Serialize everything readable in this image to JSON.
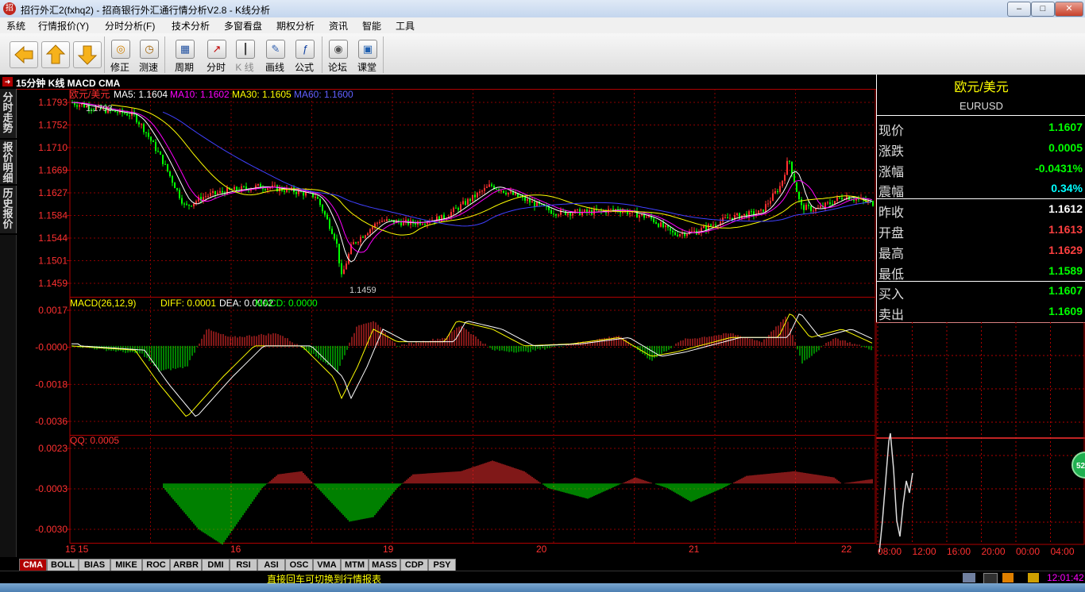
{
  "window": {
    "title": "招行外汇2(fxhq2) - 招商银行外汇通行情分析V2.8 - K线分析"
  },
  "menu": [
    "系统",
    "行情报价(Y)",
    "分时分析(F)",
    "技术分析",
    "多窗看盘",
    "期权分析",
    "资讯",
    "智能",
    "工具"
  ],
  "toolbar": {
    "buttons": [
      "修正",
      "测速",
      "周期",
      "分时",
      "K 线",
      "画线",
      "公式",
      "论坛",
      "课堂"
    ]
  },
  "side_tabs": [
    "分时走势",
    "报价明细",
    "历史报价"
  ],
  "chart_header": "15分钟 K线 MACD CMA",
  "price_panel": {
    "legend": {
      "name": "欧元/美元",
      "ma5": "MA5: 1.1604",
      "ma10": "MA10: 1.1602",
      "ma30": "MA30: 1.1605",
      "ma60": "MA60: 1.1600"
    },
    "y_ticks": [
      "1.1793",
      "1.1752",
      "1.1710",
      "1.1669",
      "1.1627",
      "1.1584",
      "1.1544",
      "1.1501",
      "1.1459"
    ],
    "high_label": "1.1793",
    "low_label": "1.1459"
  },
  "macd_panel": {
    "legend": {
      "name": "MACD(26,12,9)",
      "diff": "DIFF: 0.0001",
      "dea": "DEA: 0.0002",
      "macd": "MACD: 0.0000"
    },
    "y_ticks": [
      "0.0017",
      "-0.0000",
      "-0.0018",
      "-0.0036"
    ]
  },
  "qq_panel": {
    "legend": "QQ: 0.0005",
    "y_ticks": [
      "0.0023",
      "-0.0003",
      "-0.0030"
    ]
  },
  "x_axis": {
    "labels": [
      "15",
      "15",
      "16",
      "19",
      "20",
      "21",
      "22"
    ]
  },
  "quote": {
    "name": "欧元/美元",
    "code": "EURUSD",
    "rows": [
      {
        "k": "现价",
        "v": "1.1607",
        "c": "#00ff00"
      },
      {
        "k": "涨跌",
        "v": "0.0005",
        "c": "#00ff00"
      },
      {
        "k": "涨幅",
        "v": "-0.0431%",
        "c": "#00ff00"
      },
      {
        "k": "震幅",
        "v": "0.34%",
        "c": "#00ffff"
      },
      {
        "k": "昨收",
        "v": "1.1612",
        "c": "#ffffff"
      },
      {
        "k": "开盘",
        "v": "1.1613",
        "c": "#ff4040"
      },
      {
        "k": "最高",
        "v": "1.1629",
        "c": "#ff4040"
      },
      {
        "k": "最低",
        "v": "1.1589",
        "c": "#00ff00"
      },
      {
        "k": "买入",
        "v": "1.1607",
        "c": "#00ff00"
      },
      {
        "k": "卖出",
        "v": "1.1609",
        "c": "#00ff00"
      }
    ]
  },
  "mini_chart": {
    "x_labels": [
      "08:00",
      "12:00",
      "16:00",
      "20:00",
      "00:00",
      "04:00"
    ],
    "badge": "52"
  },
  "bottom_tabs": [
    "CMA",
    "BOLL",
    "BIAS",
    "MIKE",
    "ROC",
    "ARBR",
    "DMI",
    "RSI",
    "ASI",
    "OSC",
    "VMA",
    "MTM",
    "MASS",
    "CDP",
    "PSY"
  ],
  "status": {
    "message": "直接回车可切换到行情报表",
    "time": "12:01:42"
  },
  "colors": {
    "up": "#ff3030",
    "down": "#00ff00",
    "ma5": "#ffffff",
    "ma10": "#ff00ff",
    "ma30": "#ffff00",
    "ma60": "#4040ff",
    "grid": "#8b0000"
  }
}
